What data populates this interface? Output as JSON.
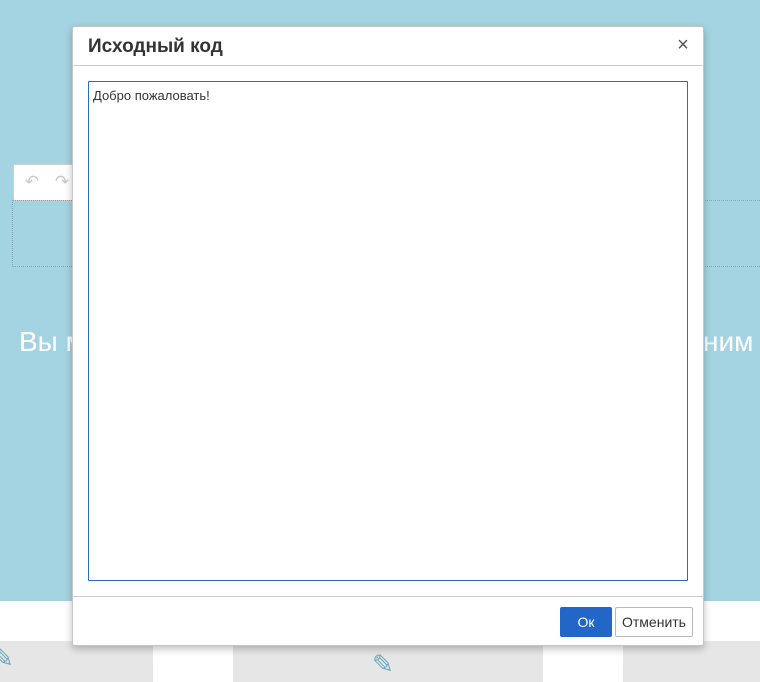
{
  "background": {
    "toolbar": {
      "undo_icon": "undo-icon",
      "redo_icon": "redo-icon",
      "undo_glyph": "↶",
      "redo_glyph": "↷"
    },
    "headline_left": "Вы м",
    "headline_right": "ним",
    "tile_icon": "edit-icon",
    "tile_glyph": "✎"
  },
  "modal": {
    "title": "Исходный код",
    "close_glyph": "×",
    "textarea_value": "Добро пожаловать!",
    "ok_label": "Ок",
    "cancel_label": "Отменить"
  },
  "colors": {
    "background": "#a4d4e2",
    "primary_button": "#2267c8",
    "textarea_border": "#2d6db8"
  }
}
